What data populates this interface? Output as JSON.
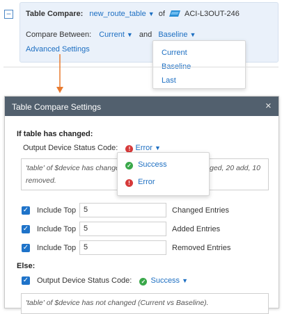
{
  "header_row": {
    "title_label": "Table Compare:",
    "table_name": "new_route_table",
    "of_text": "of",
    "device_name": "ACI-L3OUT-246"
  },
  "compare_row": {
    "label": "Compare Between:",
    "left_value": "Current",
    "and_text": "and",
    "right_value": "Baseline"
  },
  "advanced_settings_link": "Advanced Settings",
  "compare_dropdown": {
    "options": [
      "Current",
      "Baseline",
      "Last"
    ]
  },
  "dialog": {
    "title": "Table Compare Settings",
    "close_glyph": "×",
    "if_changed": {
      "heading": "If table has changed:",
      "status_label": "Output Device Status Code:",
      "status_value": "Error",
      "message": "'table' of $device has changed",
      "message_tail_right": "ged, 20 add, 10",
      "message_tail_line2": "removed."
    },
    "status_menu": {
      "options": [
        "Success",
        "Error"
      ]
    },
    "include_rows": [
      {
        "label": "Include Top",
        "value": "5",
        "suffix": "Changed Entries"
      },
      {
        "label": "Include Top",
        "value": "5",
        "suffix": "Added Entries"
      },
      {
        "label": "Include Top",
        "value": "5",
        "suffix": "Removed Entries"
      }
    ],
    "else": {
      "heading": "Else:",
      "status_label": "Output Device Status Code:",
      "status_value": "Success",
      "message": "'table' of $device has not changed (Current vs Baseline)."
    }
  },
  "colors": {
    "accent": "#1d6fc2",
    "arrow": "#e87a2f",
    "dialog_header": "#52606e",
    "error": "#d63a3a",
    "success": "#3aa84a"
  }
}
